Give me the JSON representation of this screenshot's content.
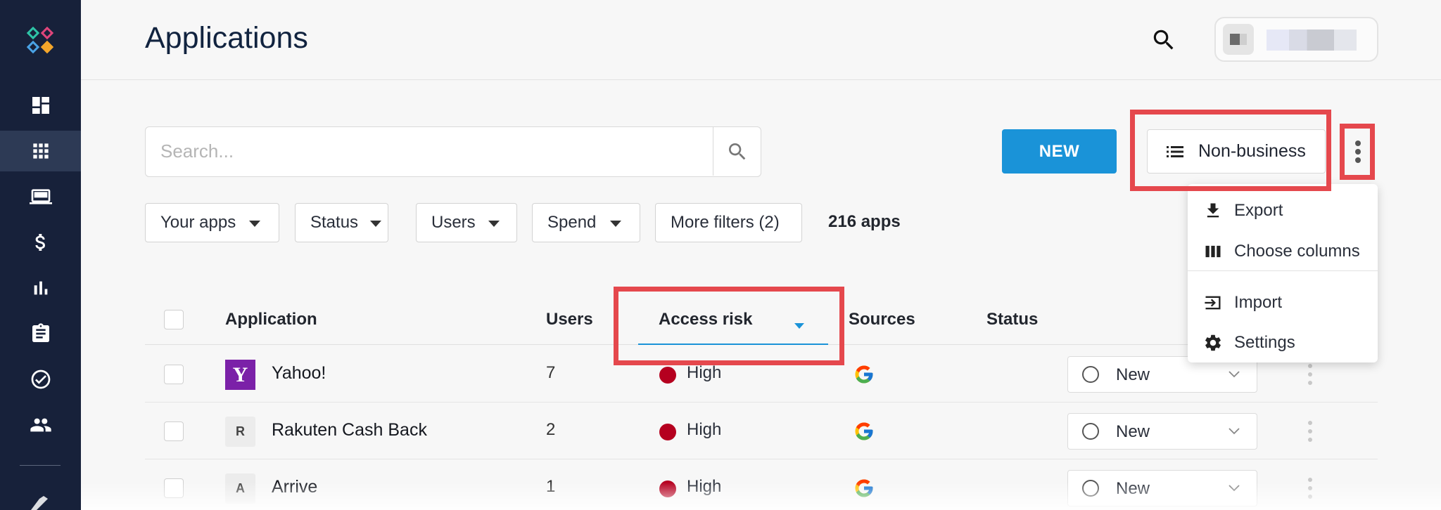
{
  "page": {
    "title": "Applications"
  },
  "header": {
    "search_icon": "search-icon",
    "user_avatar": "avatar",
    "user_name": ""
  },
  "sidebar": {
    "items": [
      {
        "icon": "dashboard-icon"
      },
      {
        "icon": "apps-grid-icon",
        "active": true
      },
      {
        "icon": "computer-icon"
      },
      {
        "icon": "dollar-icon"
      },
      {
        "icon": "bar-chart-icon"
      },
      {
        "icon": "clipboard-icon"
      },
      {
        "icon": "check-circle-icon"
      },
      {
        "icon": "people-icon"
      }
    ]
  },
  "toolbar": {
    "search_placeholder": "Search...",
    "new_label": "NEW",
    "view_label": "Non-business",
    "more_icon": "kebab-icon"
  },
  "filters": {
    "items": [
      "Your apps",
      "Status",
      "Users",
      "Spend",
      "More filters (2)"
    ],
    "count": "216 apps"
  },
  "table": {
    "columns": [
      "Application",
      "Users",
      "Access risk",
      "Sources",
      "Status"
    ],
    "sort_column": "Access risk",
    "rows": [
      {
        "logo": "Y",
        "name": "Yahoo!",
        "users": "7",
        "risk": "High",
        "source": "google-icon",
        "status": "New"
      },
      {
        "logo": "R",
        "name": "Rakuten Cash Back",
        "users": "2",
        "risk": "High",
        "source": "google-icon",
        "status": "New"
      },
      {
        "logo": "A",
        "name": "Arrive",
        "users": "1",
        "risk": "High",
        "source": "google-icon",
        "status": "New"
      }
    ]
  },
  "menu": {
    "items": [
      {
        "label": "Export",
        "icon": "download-icon"
      },
      {
        "label": "Choose columns",
        "icon": "columns-icon"
      },
      {
        "label": "Import",
        "icon": "import-icon"
      },
      {
        "label": "Settings",
        "icon": "gear-icon"
      }
    ]
  },
  "colors": {
    "sidebar": "#17213a",
    "accent": "#1a93d8",
    "risk_high": "#b5001f",
    "highlight": "#e5484d"
  }
}
